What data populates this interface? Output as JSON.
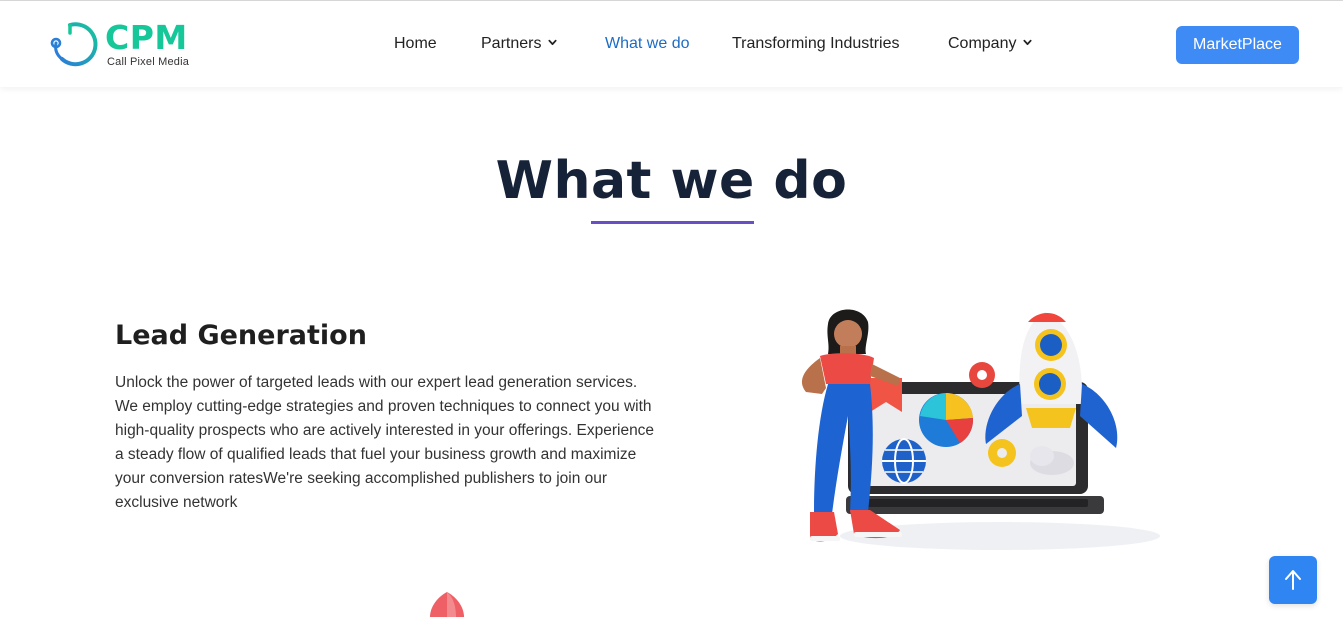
{
  "header": {
    "logo": {
      "title": "CPM",
      "subtitle": "Call Pixel Media"
    },
    "nav": [
      {
        "label": "Home",
        "has_dropdown": false,
        "active": false
      },
      {
        "label": "Partners",
        "has_dropdown": true,
        "active": false
      },
      {
        "label": "What we do",
        "has_dropdown": false,
        "active": true
      },
      {
        "label": "Transforming Industries",
        "has_dropdown": false,
        "active": false
      },
      {
        "label": "Company",
        "has_dropdown": true,
        "active": false
      }
    ],
    "cta_label": "MarketPlace"
  },
  "main": {
    "title": "What we do",
    "section": {
      "heading": "Lead Generation",
      "body": "Unlock the power of targeted leads with our expert lead generation services. We employ cutting‐edge strategies and proven techniques to connect you with high-quality prospects who are actively interested in your offerings. Experience a steady flow of qualified leads that fuel your business growth and maximize your conversion ratesWe're seeking accomplished publishers to join our exclusive network"
    }
  },
  "icons": {
    "dropdown": "chevron-down-icon",
    "scroll_top": "arrow-up-icon",
    "logo_mark": "headset-logo-icon"
  },
  "colors": {
    "brand_green": "#16c79a",
    "brand_blue": "#2a9fd6",
    "active_nav": "#1c6cc4",
    "cta": "#3e8bf5",
    "title": "#152238",
    "underline": "#6650c4",
    "scroll_button": "#2f86f2"
  }
}
